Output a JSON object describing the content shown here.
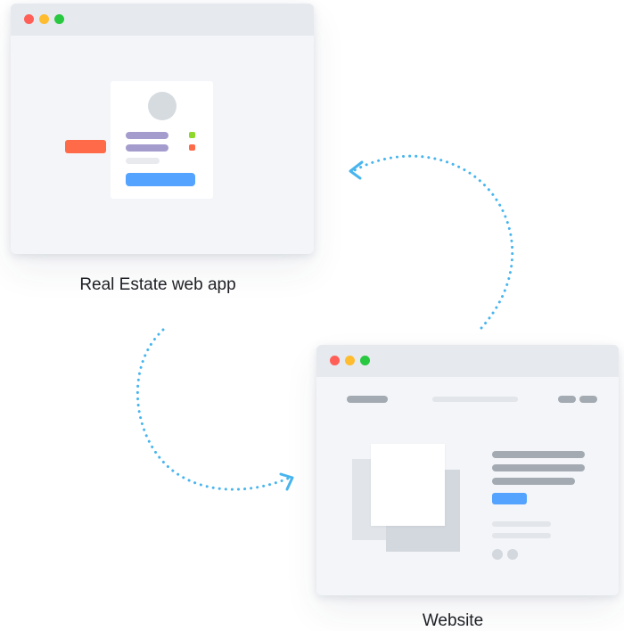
{
  "colors": {
    "dot_close": "#ff5f57",
    "dot_min": "#febc2e",
    "dot_max": "#28c840",
    "accent_blue": "#54a3ff",
    "accent_orange": "#ff6a49",
    "accent_green": "#8ed72b",
    "lavender": "#a59cce",
    "arrow": "#48b5ee"
  },
  "app_window": {
    "caption": "Real Estate web app",
    "card_elements": [
      "avatar-icon",
      "name-line",
      "subtitle-line",
      "status-green",
      "status-orange",
      "meta-line",
      "action-button"
    ]
  },
  "website_window": {
    "caption": "Website",
    "elements": [
      "nav-logo",
      "nav-search",
      "nav-links",
      "image-stack",
      "heading-lines",
      "cta-button",
      "text-lines",
      "pagination-dots"
    ]
  },
  "arrows": [
    {
      "name": "arrow-to-app",
      "direction": "website-to-app"
    },
    {
      "name": "arrow-to-website",
      "direction": "app-to-website"
    }
  ]
}
